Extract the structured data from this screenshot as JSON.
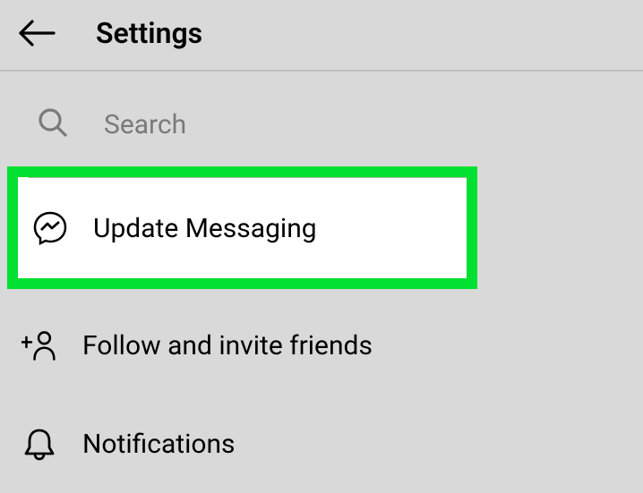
{
  "header": {
    "title": "Settings"
  },
  "search": {
    "placeholder": "Search"
  },
  "menu": {
    "update_messaging": {
      "label": "Update Messaging"
    },
    "follow_invite": {
      "label": "Follow and invite friends"
    },
    "notifications": {
      "label": "Notifications"
    }
  }
}
